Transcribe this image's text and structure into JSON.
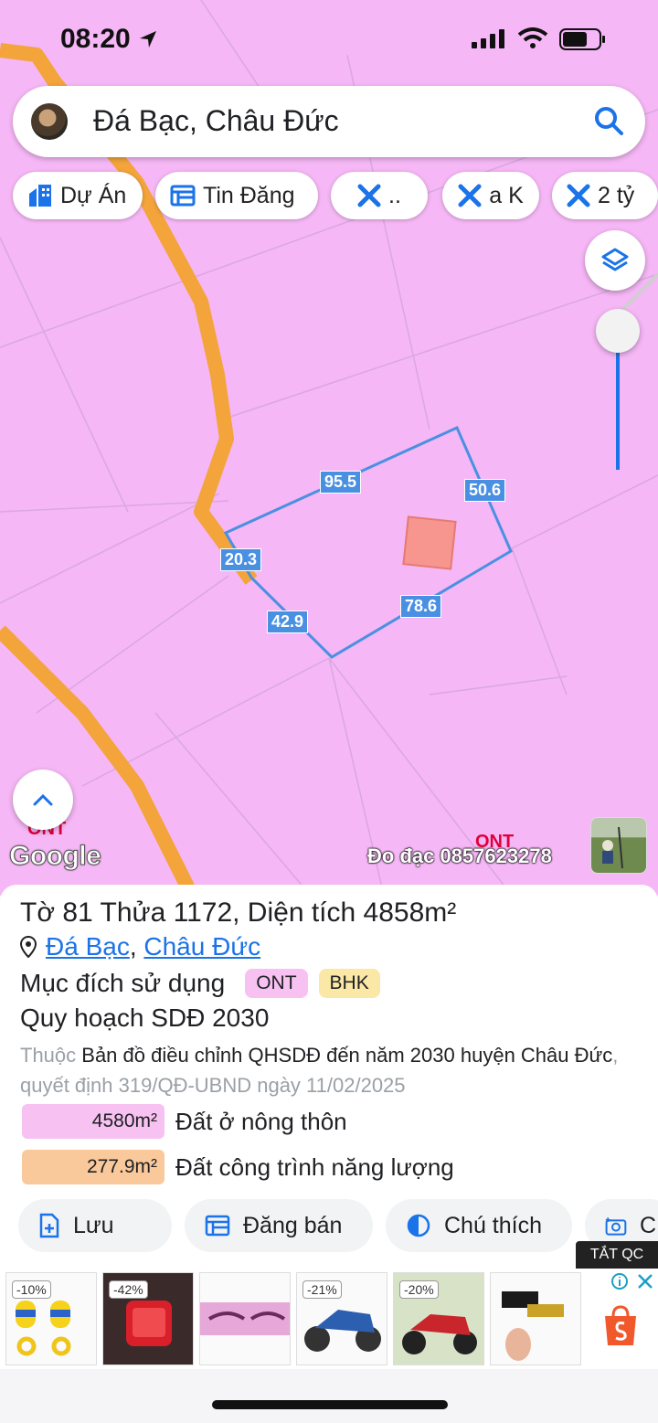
{
  "status": {
    "time": "08:20"
  },
  "search": {
    "query": "Đá Bạc, Châu Đức"
  },
  "chips": [
    {
      "label": "Dự Án",
      "icon": "building-icon"
    },
    {
      "label": "Tin Đăng",
      "icon": "listing-icon"
    },
    {
      "label": "..",
      "icon": "ruler-icon"
    },
    {
      "label": "a K",
      "icon": "ruler-icon"
    },
    {
      "label": "2 tỷ",
      "icon": "ruler-icon"
    }
  ],
  "map": {
    "edges": [
      "95.5",
      "50.6",
      "20.3",
      "78.6",
      "42.9"
    ],
    "zone_labels": [
      "ONT",
      "ONT"
    ],
    "logo": "Google",
    "watermark": "Đo đạc 0857623278"
  },
  "parcel": {
    "title_prefix": "Tờ ",
    "sheet_no": "81",
    "plot_label": " Thửa ",
    "plot_no": "1172",
    "area_label": ", Diện tích ",
    "area_value": "4858",
    "area_unit": "m²",
    "commune": "Đá Bạc",
    "separator": ", ",
    "district": "Châu Đức",
    "purpose_label": "Mục đích sử dụng",
    "purpose_tags": [
      "ONT",
      "BHK"
    ],
    "plan_title": "Quy hoạch SDĐ 2030",
    "desc_muted_1": "Thuộc ",
    "desc_main": "Bản đồ điều chỉnh QHSDĐ đến năm 2030 huyện Châu Đức",
    "desc_muted_2": ", quyết định 319/QĐ-UBND ngày 11/02/2025",
    "areas": [
      {
        "value": "4580m²",
        "label": "Đất ở nông thôn",
        "color": "#f7c1f2"
      },
      {
        "value": "277.9m²",
        "label": "Đất công trình năng lượng",
        "color": "#f9c99b"
      }
    ]
  },
  "actions": [
    {
      "label": "Lưu",
      "icon": "save-icon"
    },
    {
      "label": "Đăng bán",
      "icon": "listing-icon"
    },
    {
      "label": "Chú thích",
      "icon": "contrast-icon"
    },
    {
      "label": "C",
      "icon": "camera-icon"
    }
  ],
  "ads": {
    "close_label": "TẮT QC",
    "discounts": [
      "-10%",
      "-42%",
      "",
      "-21%",
      "-20%",
      ""
    ]
  },
  "colors": {
    "map_bg": "#f5b7f5",
    "road": "#f3a43a",
    "parcel_line": "#4a90e2",
    "link": "#1a73e8",
    "ont_tag": "#f7c1f2",
    "bhk_tag": "#fbe8a6"
  }
}
